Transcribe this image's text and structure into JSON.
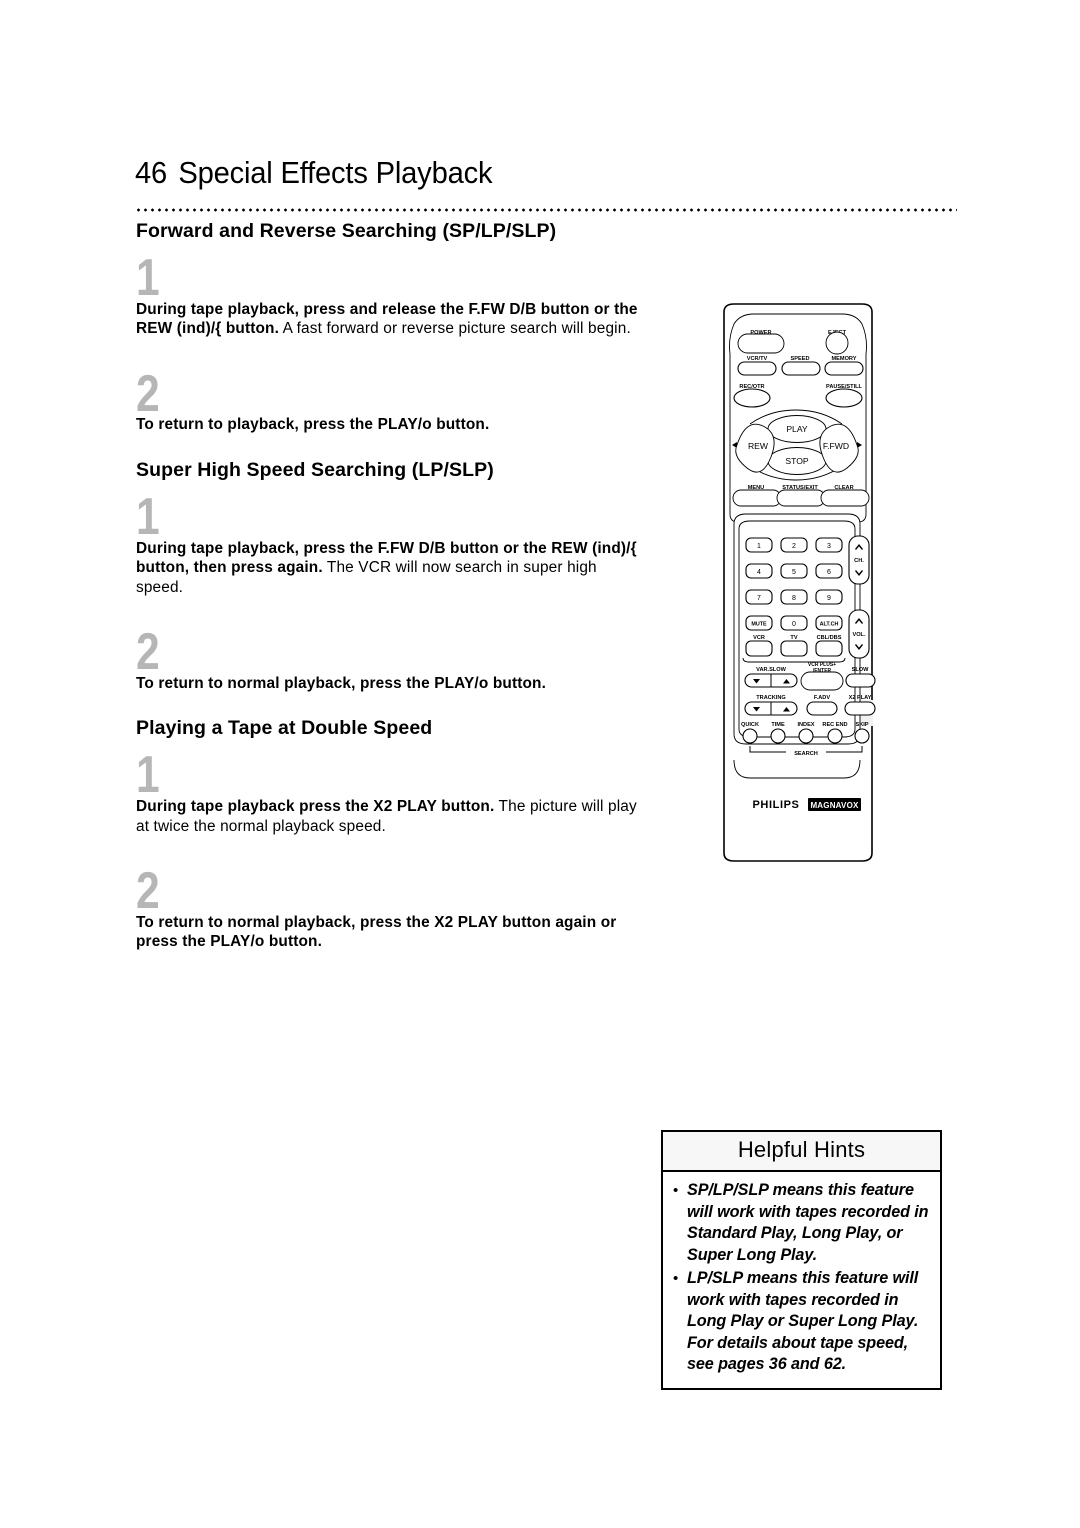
{
  "page": {
    "number": "46",
    "title": "Special Effects Playback"
  },
  "sections": [
    {
      "heading": "Forward and Reverse Searching (SP/LP/SLP)",
      "steps": [
        {
          "number": "1",
          "bold": "During tape playback, press and release the F.FW D/B button or the REW (ind)/{ button.",
          "normal": " A fast forward or reverse picture search will begin."
        },
        {
          "number": "2",
          "bold": "To return to playback, press the PLAY/o button.",
          "normal": ""
        }
      ]
    },
    {
      "heading": "Super High Speed Searching (LP/SLP)",
      "steps": [
        {
          "number": "1",
          "bold": "During tape playback, press the F.FW D/B button or the REW (ind)/{ button, then press again.",
          "normal": " The VCR will now search in super high speed."
        },
        {
          "number": "2",
          "bold": "To return to normal playback, press the PLAY/o button.",
          "normal": ""
        }
      ]
    },
    {
      "heading": "Playing a Tape at Double Speed",
      "steps": [
        {
          "number": "1",
          "bold": "During tape playback press the X2 PLAY button.",
          "normal": " The picture will play at twice the normal playback speed."
        },
        {
          "number": "2",
          "bold": "To return to normal playback, press the X2 PLAY button again or press the PLAY/o button.",
          "normal": ""
        }
      ]
    }
  ],
  "helpful_hints": {
    "title": "Helpful Hints",
    "bullet": "•",
    "items": [
      "SP/LP/SLP means this feature will work with tapes recorded in Standard Play, Long Play, or Super Long Play.",
      "LP/SLP means this feature will work with tapes recorded in Long Play or Super Long Play. For details about tape speed, see pages 36 and 62."
    ]
  },
  "remote": {
    "brand_primary": "PHILIPS",
    "brand_secondary": "MAGNAVOX",
    "labels": {
      "power": "POWER",
      "eject": "EJECT",
      "vcr_tv": "VCR/TV",
      "speed": "SPEED",
      "memory": "MEMORY",
      "rec_otr": "REC/OTR",
      "pause_still": "PAUSE/STILL",
      "play": "PLAY",
      "rew": "REW",
      "ffwd": "F.FWD",
      "stop": "STOP",
      "menu": "MENU",
      "status_exit": "STATUS/EXIT",
      "clear": "CLEAR",
      "ch": "CH.",
      "vol": "VOL.",
      "mute": "MUTE",
      "alt_ch": "ALT.CH",
      "vcr": "VCR",
      "tv": "TV",
      "cbl_dbs": "CBL/DBS",
      "var_slow": "VAR.SLOW",
      "vcr_plus_line1": "VCR PLUS+",
      "vcr_plus_line2": "/ENTER",
      "slow": "SLOW",
      "tracking": "TRACKING",
      "f_adv": "F.ADV",
      "x2_play": "X2 PLAY",
      "quick": "QUICK",
      "time": "TIME",
      "index": "INDEX",
      "rec_end": "REC END",
      "skip": "SKIP",
      "search": "SEARCH"
    },
    "keypad": [
      "1",
      "2",
      "3",
      "4",
      "5",
      "6",
      "7",
      "8",
      "9",
      "0"
    ]
  },
  "colors": {
    "step_number_gray": "#b6b6b6",
    "highlight_gray": "#f1f1f1",
    "ink": "#000000",
    "paper": "#ffffff"
  }
}
